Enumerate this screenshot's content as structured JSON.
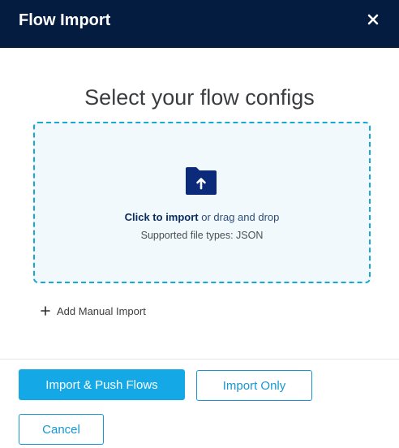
{
  "header": {
    "title": "Flow Import",
    "close_icon": "close-icon"
  },
  "main": {
    "title": "Select your flow configs",
    "dropzone": {
      "icon": "folder-upload-icon",
      "link_text": "Click to import",
      "rest_text": " or drag and drop",
      "supported": "Supported file types: JSON"
    },
    "add_manual": {
      "icon": "plus-icon",
      "label": "Add Manual Import"
    }
  },
  "footer": {
    "primary_label": "Import & Push Flows",
    "secondary_label": "Import Only",
    "cancel_label": "Cancel"
  },
  "colors": {
    "header_bg": "#031c40",
    "accent": "#15a8e6",
    "dropzone_border": "#17a9d6",
    "dropzone_bg": "#f1f9fd",
    "folder_icon": "#0b2a7a"
  }
}
